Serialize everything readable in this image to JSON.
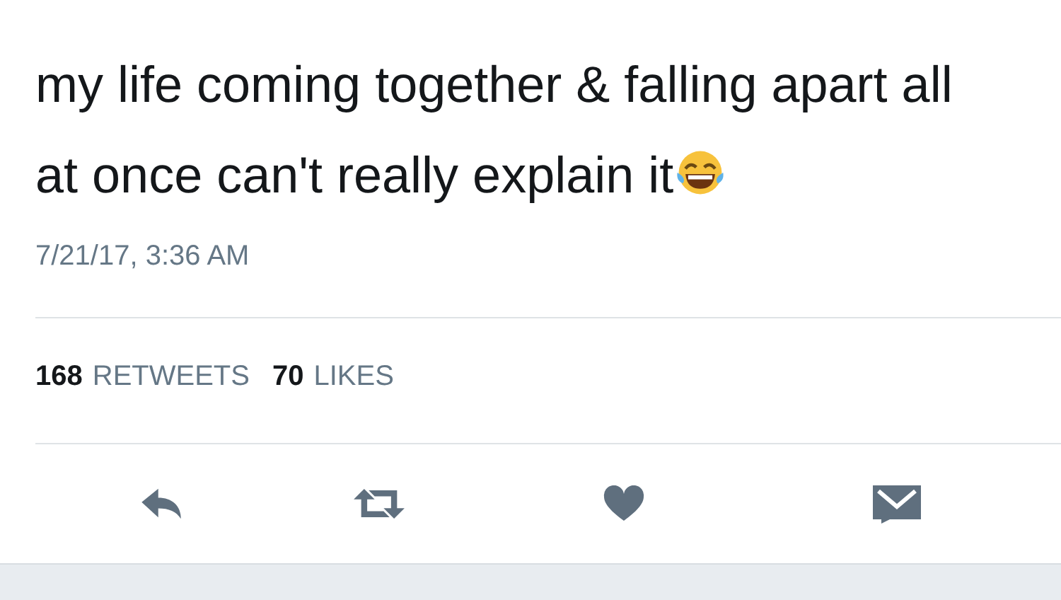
{
  "tweet": {
    "lines": [
      "my life coming together & falling apart all",
      "at once can't really explain it"
    ],
    "timestamp": "7/21/17, 3:36 AM"
  },
  "stats": [
    {
      "count": "168",
      "label": "RETWEETS"
    },
    {
      "count": "70",
      "label": "LIKES"
    }
  ],
  "actions": [
    {
      "kind": "reply"
    },
    {
      "kind": "retweet"
    },
    {
      "kind": "like"
    },
    {
      "kind": "message"
    }
  ]
}
